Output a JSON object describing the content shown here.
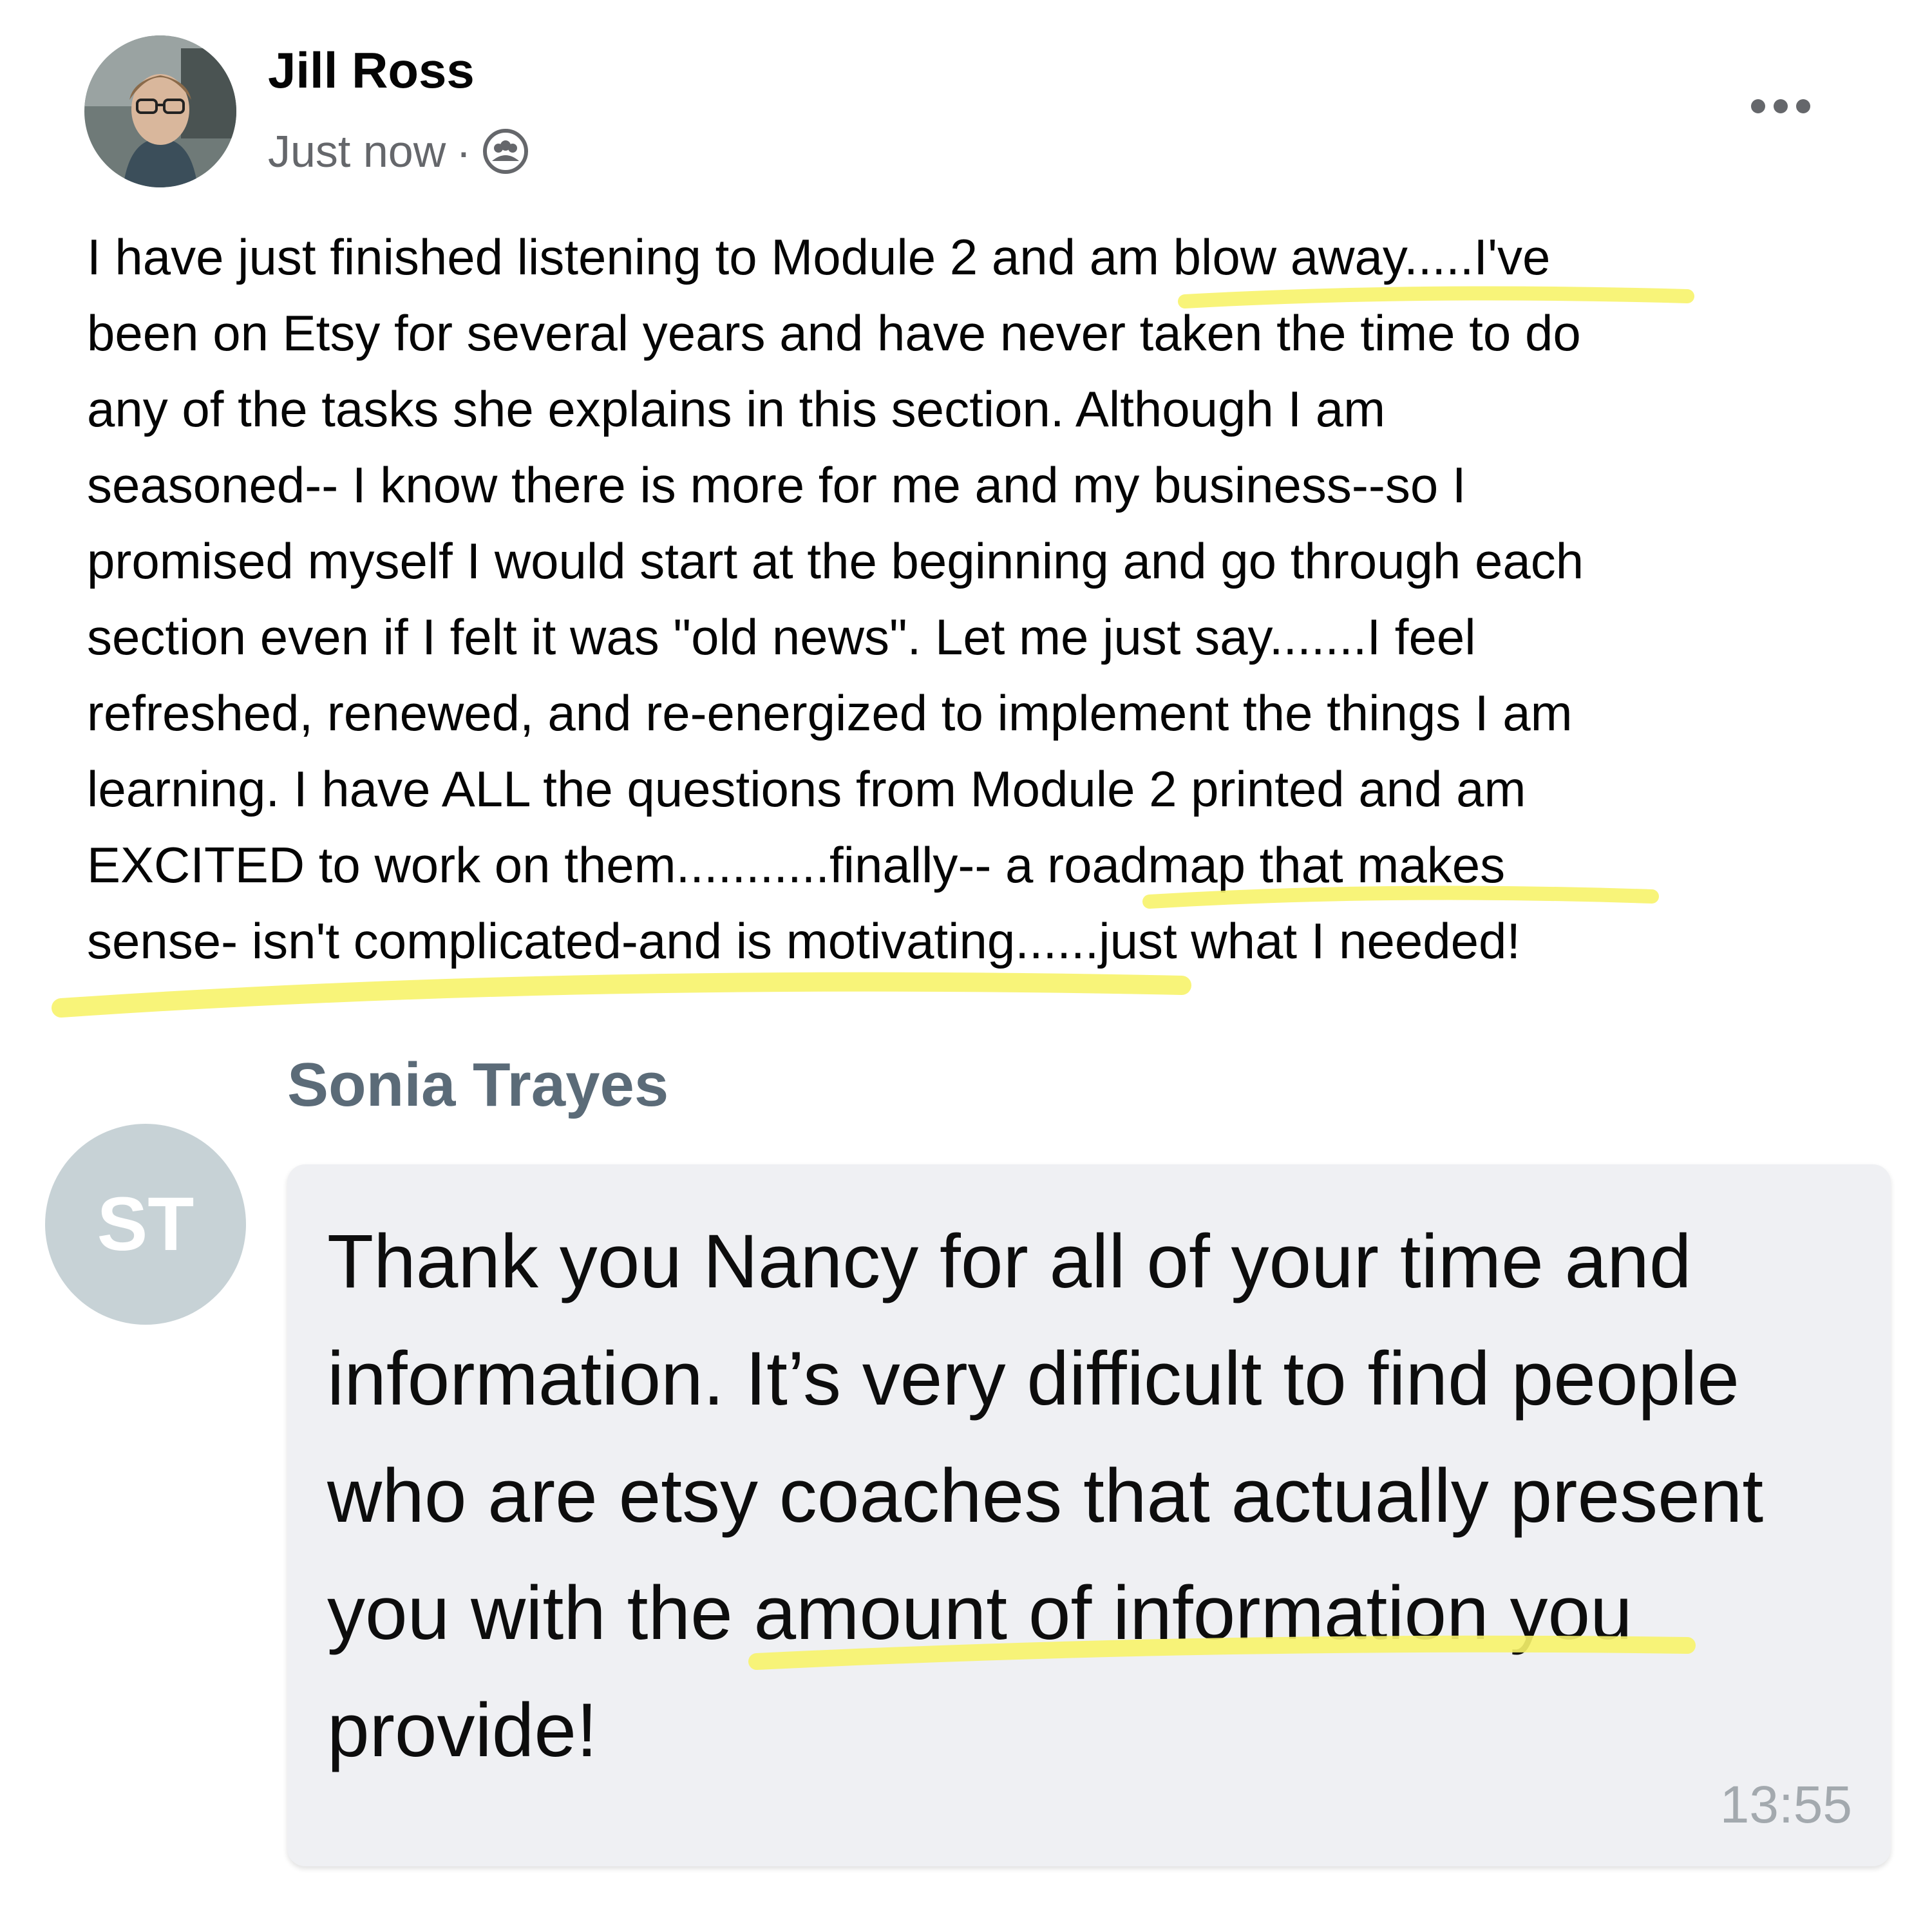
{
  "post": {
    "author": "Jill Ross",
    "timestamp": "Just now",
    "separator": "·",
    "audience_icon": "group-audience-icon",
    "more_icon": "more-options-icon",
    "body_lines": [
      "I have just finished listening to Module 2 and am blow away.....I've",
      "been on Etsy for several years and have never taken the time to do",
      "any of the tasks she explains in this section. Although I am",
      "seasoned-- I know there is more for me and my business--so I",
      "promised myself I would start at the beginning and go through each",
      "section even if I felt it was \"old news\". Let me just say.......I feel",
      "refreshed, renewed, and re-energized to implement the things I am",
      "learning. I have ALL the questions from Module 2 printed and am",
      "EXCITED to work on them...........finally-- a roadmap that makes",
      "sense- isn't complicated-and is motivating......just what I needed!"
    ]
  },
  "reply": {
    "author": "Sonia Trayes",
    "initials": "ST",
    "message_lines": [
      "Thank you Nancy for all of your time and",
      "information. It’s very difficult to find people",
      "who are etsy coaches that actually present",
      "you with the amount of information you",
      "provide!"
    ],
    "time": "13:55"
  },
  "colors": {
    "highlight": "#f7f36a",
    "reply_author": "#5b6b78",
    "reply_avatar_bg": "#c7d2d6",
    "bubble_bg": "#eff0f3",
    "meta_text": "#65676b"
  }
}
